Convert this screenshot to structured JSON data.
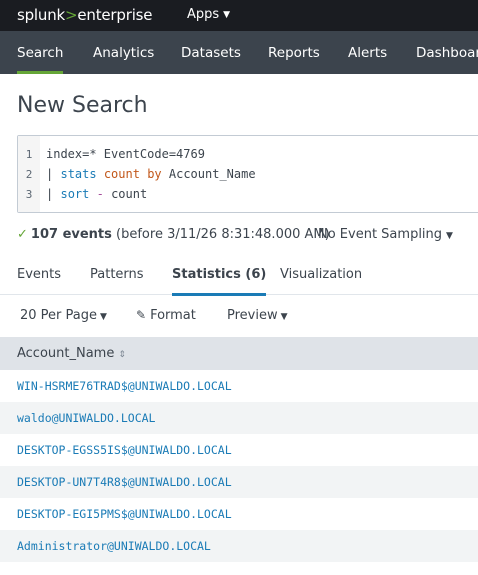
{
  "header": {
    "logo_splunk": "splunk",
    "logo_gt": ">",
    "logo_product": "enterprise",
    "apps_label": "Apps"
  },
  "nav": {
    "items": [
      {
        "label": "Search",
        "active": true
      },
      {
        "label": "Analytics",
        "active": false
      },
      {
        "label": "Datasets",
        "active": false
      },
      {
        "label": "Reports",
        "active": false
      },
      {
        "label": "Alerts",
        "active": false
      },
      {
        "label": "Dashboards",
        "active": false
      }
    ]
  },
  "page": {
    "title": "New Search"
  },
  "query": {
    "lines": [
      {
        "num": "1",
        "parts": [
          "index=* EventCode=4769"
        ]
      },
      {
        "num": "2",
        "pipe": "|",
        "cmd": "stats",
        "fn": "count",
        "op": "by",
        "rest": "Account_Name"
      },
      {
        "num": "3",
        "pipe": "|",
        "cmd": "sort",
        "op": "-",
        "rest": "count"
      }
    ]
  },
  "status": {
    "check": "✓",
    "events_count": "107 events",
    "events_detail": "(before 3/11/26 8:31:48.000 AM)",
    "sampling": "No Event Sampling"
  },
  "tabs": [
    {
      "label": "Events",
      "active": false
    },
    {
      "label": "Patterns",
      "active": false
    },
    {
      "label": "Statistics (6)",
      "active": true
    },
    {
      "label": "Visualization",
      "active": false
    }
  ],
  "toolbar": {
    "per_page": "20 Per Page",
    "format": "Format",
    "preview": "Preview"
  },
  "table": {
    "columns": [
      "Account_Name"
    ],
    "rows": [
      "WIN-HSRME76TRAD$@UNIWALDO.LOCAL",
      "waldo@UNIWALDO.LOCAL",
      "DESKTOP-EGSS5IS$@UNIWALDO.LOCAL",
      "DESKTOP-UN7T4R8$@UNIWALDO.LOCAL",
      "DESKTOP-EGI5PMS$@UNIWALDO.LOCAL",
      "Administrator@UNIWALDO.LOCAL"
    ]
  },
  "colors": {
    "accent_green": "#65a637",
    "link_blue": "#1a7bb6",
    "nav_bg": "#3c444d",
    "topbar_bg": "#1a1c21"
  },
  "icons": {
    "check": "check-icon",
    "caret": "caret-down-icon",
    "pencil": "pencil-icon",
    "sort": "sort-icon"
  }
}
